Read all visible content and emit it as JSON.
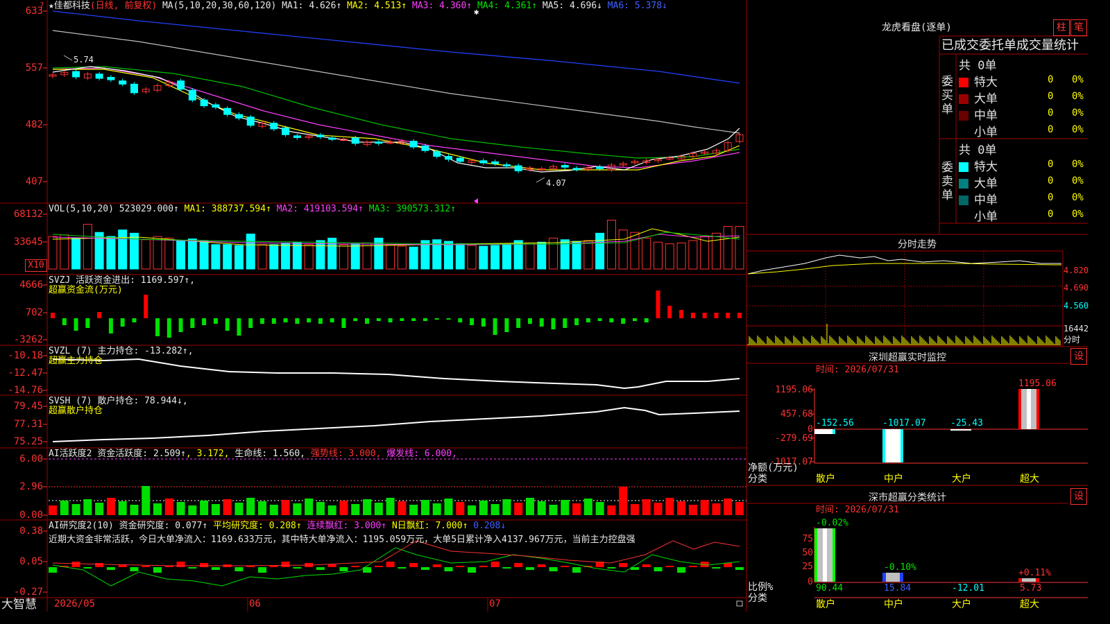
{
  "header": {
    "star": "★",
    "stock_name": "佳都科技",
    "mode": "(日线, 前复权)",
    "ma_text": "MA(5,10,20,30,60,120)",
    "ma1": "MA1: 4.626↑",
    "ma2": "MA2: 4.513↑",
    "ma3": "MA3: 4.360↑",
    "ma4": "MA4: 4.361↑",
    "ma5": "MA5: 4.696↓",
    "ma6": "MA6: 5.378↓"
  },
  "price_axis": [
    "633",
    "557",
    "482",
    "407"
  ],
  "price_marks": {
    "high": "5.74",
    "low": "4.07"
  },
  "vol_header": {
    "name": "VOL(5,10,20)",
    "value": "523029.000↑",
    "ma1": "MA1: 388737.594↑",
    "ma2": "MA2: 419103.594↑",
    "ma3": "MA3: 390573.312↑"
  },
  "vol_axis": [
    "68132",
    "33645"
  ],
  "vol_unit": "X10",
  "svzj": {
    "header": "SVZJ  活跃资金进出: 1169.597↑,",
    "sub": "超赢资金流(万元)",
    "axis": [
      "4666",
      "702",
      "-3262"
    ]
  },
  "svzl": {
    "header": "SVZL (7) 主力持仓: -13.282↑,",
    "sub": "超赢主力持仓",
    "axis": [
      "-10.18",
      "-12.47",
      "-14.76"
    ]
  },
  "svsh": {
    "header": "SVSH (7) 散户持仓: 78.944↓,",
    "sub": "超赢散户持仓",
    "axis": [
      "79.45",
      "77.31",
      "75.25"
    ]
  },
  "ai1": {
    "name": "AI活跃度2 资金活跃度: 2.509↑",
    "v2": ", 3.172,",
    "life": "生命线: 1.560,",
    "strong": "强势线: 3.000,",
    "burst": "爆发线: 6.000,",
    "axis": [
      "6.00",
      "2.96",
      "0.00"
    ]
  },
  "ai2": {
    "name": "AI研究度2(10) 资金研究度: 0.077↑",
    "avg": "平均研究度: 0.208↑",
    "cont": "连续飘红: 3.000↑",
    "nday": "N日飘红: 7.000↑",
    "last": "0.208↓",
    "desc": "近期大资金非常活跃，今日大单净流入：1169.633万元，其中特大单净流入：1195.059万元，大单5日累计净入4137.967万元，当前主力控盘强",
    "axis": [
      "0.38",
      "0.05",
      "-0.27"
    ]
  },
  "xaxis": [
    "2026/05",
    "06",
    "07"
  ],
  "brand": "大智慧",
  "right": {
    "lhk_title": "龙虎看盘(逐单)",
    "btn1": "柱",
    "btn2": "笔",
    "tabs": "已成交委托单成交量统计",
    "buy_label": "委买单",
    "sell_label": "委卖单",
    "buy_total": "共 0单",
    "sell_total": "共 0单",
    "buy_rows": [
      {
        "name": "特大",
        "count": "0",
        "pct": "0%",
        "color": "#ff0000"
      },
      {
        "name": "大单",
        "count": "0",
        "pct": "0%",
        "color": "#9a0000"
      },
      {
        "name": "中单",
        "count": "0",
        "pct": "0%",
        "color": "#6a0000"
      },
      {
        "name": "小单",
        "count": "0",
        "pct": "0%",
        "color": ""
      }
    ],
    "sell_rows": [
      {
        "name": "特大",
        "count": "0",
        "pct": "0%",
        "color": "#00ffff"
      },
      {
        "name": "大单",
        "count": "0",
        "pct": "0%",
        "color": "#008080"
      },
      {
        "name": "中单",
        "count": "0",
        "pct": "0%",
        "color": "#006666"
      },
      {
        "name": "小单",
        "count": "0",
        "pct": "0%",
        "color": ""
      }
    ],
    "fenshi_title": "分时走势",
    "fenshi_axis": [
      "4.820",
      "4.690",
      "4.560",
      "16442",
      "分时"
    ],
    "sz_title": "深圳超赢实时监控",
    "sz_set": "设",
    "sz_time": "时间: 2026/07/31",
    "sz_axis": [
      "1195.06",
      "457.68",
      "0",
      "-279.69",
      "-1017.07"
    ],
    "sz_unit": "净额(万元)",
    "sz_cat_label": "分类",
    "sz_vals": [
      "-152.56",
      "-1017.07",
      "-25.43",
      "1195.06"
    ],
    "cats": [
      "散户",
      "中户",
      "大户",
      "超大"
    ],
    "ss_title": "深市超赢分类统计",
    "ss_set": "设",
    "ss_time": "时间: 2026/07/31",
    "ss_axis": [
      "75",
      "50",
      "25",
      "0"
    ],
    "ss_unit": "比例%",
    "ss_cat_label": "分类",
    "ss_pct": [
      "-0.02%",
      "-0.10%",
      "",
      "+0.11%"
    ],
    "ss_vals": [
      "90.44",
      "15.84",
      "-12.01",
      "5.73"
    ]
  },
  "chart_data": [
    {
      "type": "candlestick",
      "title": "佳都科技 (日线, 前复权)",
      "ylim": [
        4.07,
        5.74
      ],
      "note": "daily candles from 2026/05 to 2026/07, close trend approx",
      "close": [
        5.55,
        5.58,
        5.52,
        5.56,
        5.5,
        5.48,
        5.42,
        5.3,
        5.35,
        5.4,
        5.45,
        5.35,
        5.2,
        5.12,
        5.1,
        5.0,
        4.95,
        4.85,
        4.88,
        4.8,
        4.72,
        4.68,
        4.7,
        4.69,
        4.66,
        4.66,
        4.6,
        4.62,
        4.6,
        4.62,
        4.63,
        4.55,
        4.5,
        4.42,
        4.38,
        4.35,
        4.36,
        4.33,
        4.32,
        4.29,
        4.22,
        4.26,
        4.25,
        4.28,
        4.27,
        4.24,
        4.26,
        4.25,
        4.3,
        4.32,
        4.35,
        4.36,
        4.38,
        4.4,
        4.42,
        4.46,
        4.48,
        4.5,
        4.61,
        4.72
      ]
    },
    {
      "type": "bar",
      "title": "VOL(5,10,20)",
      "values": [
        40000,
        42000,
        38000,
        55000,
        45000,
        40000,
        48000,
        44000,
        36000,
        40000,
        38000,
        35000,
        37000,
        35000,
        30000,
        30000,
        29000,
        43000,
        30000,
        30000,
        32000,
        33000,
        30000,
        35000,
        38000,
        30000,
        31000,
        32000,
        38000,
        30000,
        28000,
        27000,
        35000,
        36000,
        34000,
        31000,
        29000,
        28000,
        29000,
        31000,
        35000,
        32000,
        33000,
        38000,
        36000,
        34000,
        35000,
        44000,
        60000,
        48000,
        45000,
        38000,
        33000,
        31000,
        32000,
        35000,
        40000,
        44000,
        52300,
        52300
      ]
    }
  ]
}
